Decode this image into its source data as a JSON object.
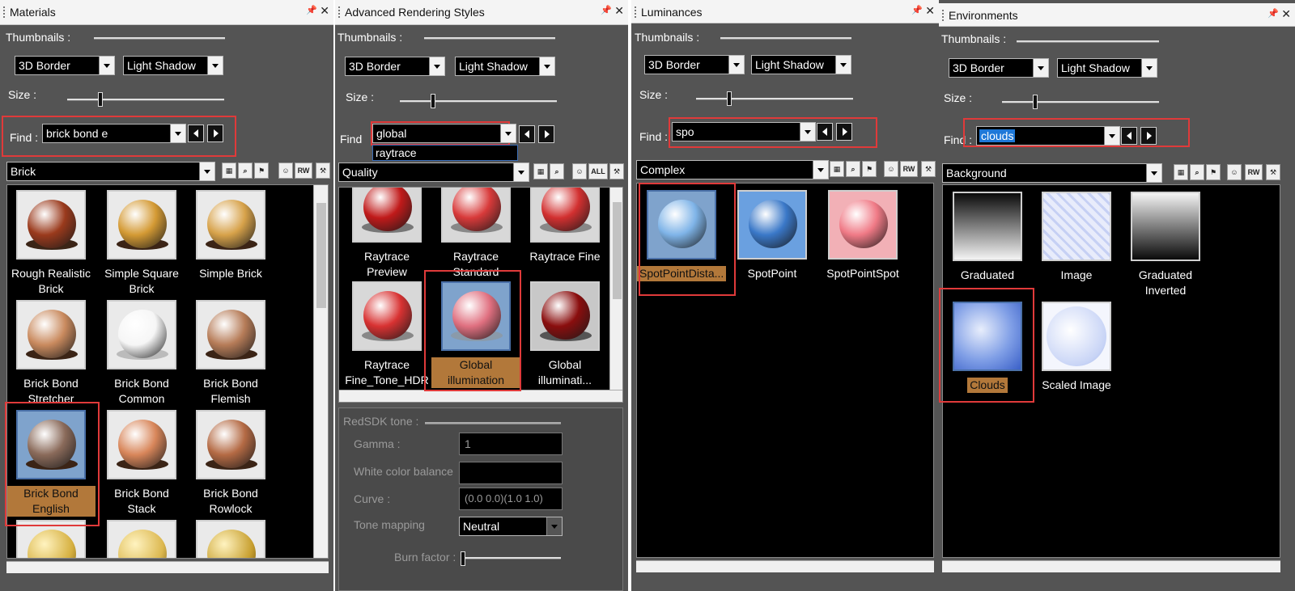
{
  "labels": {
    "thumbnails": "Thumbnails :",
    "size": "Size :",
    "find": "Find :",
    "find_short": "Find"
  },
  "colors": {
    "panel_bg": "#545454",
    "highlight": "#e03a3a",
    "selected_label": "#b2783a",
    "selection_blue": "#1e78d8"
  },
  "materials": {
    "title": "Materials",
    "border_style": "3D Border",
    "shadow_style": "Light Shadow",
    "size_level": 0.2,
    "find_value": "brick bond e",
    "category": "Brick",
    "items": [
      {
        "label": "Rough Realistic Brick",
        "color": "#9a3a1c",
        "selected": false
      },
      {
        "label": "Simple Square Brick",
        "color": "#d49a34",
        "selected": false
      },
      {
        "label": "Simple Brick",
        "color": "#d7a24a",
        "selected": false
      },
      {
        "label": "Brick Bond Stretcher",
        "color": "#c98a5e",
        "selected": false
      },
      {
        "label": "Brick Bond Common",
        "color": "#f6f6f6",
        "selected": false
      },
      {
        "label": "Brick Bond Flemish",
        "color": "#b67c58",
        "selected": false
      },
      {
        "label": "Brick Bond English",
        "color": "#8a6a5a",
        "selected": true
      },
      {
        "label": "Brick Bond Stack",
        "color": "#d8865a",
        "selected": false
      },
      {
        "label": "Brick Bond Rowlock",
        "color": "#b46a44",
        "selected": false
      }
    ]
  },
  "rendering": {
    "title": "Advanced Rendering Styles",
    "border_style": "3D Border",
    "shadow_style": "Light Shadow",
    "size_level": 0.2,
    "find_value": "global",
    "suggestion": "raytrace",
    "category": "Quality",
    "items": [
      {
        "label": "Raytrace Preview",
        "color": "#c01a1a",
        "selected": false
      },
      {
        "label": "Raytrace Standard",
        "color": "#d83a3a",
        "selected": false
      },
      {
        "label": "Raytrace Fine",
        "color": "#d23030",
        "selected": false
      },
      {
        "label": "Raytrace Fine_Tone_HDR",
        "color": "#d83232",
        "selected": false
      },
      {
        "label": "Global illumination",
        "color": "#e07080",
        "selected": true
      },
      {
        "label": "Global illuminati...",
        "color": "#8a0e0e",
        "selected": false
      }
    ],
    "tone": {
      "section": "RedSDK tone :",
      "gamma_label": "Gamma :",
      "gamma_value": "1",
      "white_balance_label": "White color balance",
      "curve_label": "Curve :",
      "curve_value": "(0.0 0.0)(1.0 1.0)",
      "tone_mapping_label": "Tone mapping",
      "tone_mapping_value": "Neutral",
      "burn_label": "Burn factor :"
    }
  },
  "luminances": {
    "title": "Luminances",
    "border_style": "3D Border",
    "shadow_style": "Light Shadow",
    "size_level": 0.2,
    "find_value": "spo",
    "category": "Complex",
    "items": [
      {
        "label": "SpotPointDista...",
        "color": "#7fb4e8",
        "selected": true
      },
      {
        "label": "SpotPoint",
        "color": "#3a78c8",
        "selected": false
      },
      {
        "label": "SpotPointSpot",
        "color": "#f07a86",
        "selected": false
      }
    ]
  },
  "environments": {
    "title": "Environments",
    "border_style": "3D Border",
    "shadow_style": "Light Shadow",
    "size_level": 0.2,
    "find_value": "clouds",
    "category": "Background",
    "items": [
      {
        "label": "Graduated",
        "color": "#888888",
        "selected": false
      },
      {
        "label": "Image",
        "color": "#dfe4f8",
        "selected": false
      },
      {
        "label": "Graduated Inverted",
        "color": "#777777",
        "selected": false
      },
      {
        "label": "Clouds",
        "color": "#7f9ee6",
        "selected": true
      },
      {
        "label": "Scaled Image",
        "color": "#dde6fb",
        "selected": false
      }
    ]
  }
}
